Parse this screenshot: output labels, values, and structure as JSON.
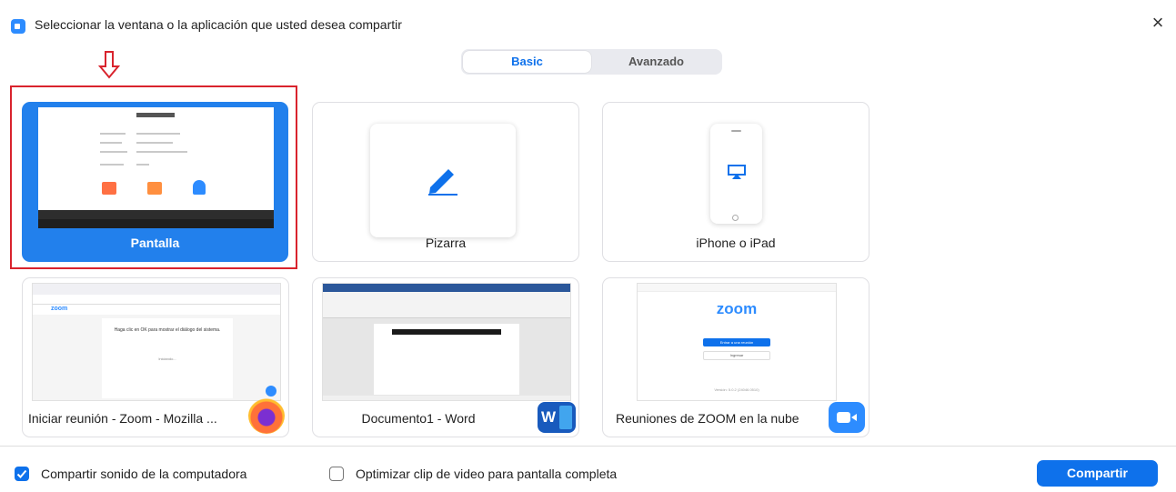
{
  "window": {
    "title": "Seleccionar la ventana o la aplicación que usted desea compartir",
    "close_icon": "close-icon"
  },
  "tabs": [
    {
      "label": "Basic",
      "selected": true
    },
    {
      "label": "Avanzado",
      "selected": false
    }
  ],
  "annotation": {
    "icon": "red-down-arrow-icon",
    "color": "#d9232d"
  },
  "options": [
    {
      "label": "Pantalla",
      "type": "screen",
      "selected": true
    },
    {
      "label": "Pizarra",
      "type": "whiteboard",
      "icon": "pencil-icon"
    },
    {
      "label": "iPhone o iPad",
      "type": "device",
      "icon": "airplay-icon"
    },
    {
      "label": "Iniciar reunión - Zoom - Mozilla ...",
      "type": "window",
      "app_icon": "firefox-icon"
    },
    {
      "label": "Documento1 - Word",
      "type": "window",
      "app_icon": "word-icon"
    },
    {
      "label": "Reuniones de ZOOM en la nube",
      "type": "window",
      "app_icon": "zoom-icon"
    }
  ],
  "previews": {
    "firefox": {
      "logo": "zoom",
      "text": "Haga clic en OK para mostrar el diálogo del sistema.",
      "loading": "Iniciando..."
    },
    "zoom_app": {
      "logo": "zoom",
      "join": "Entrar a una reunión",
      "signin": "Ingresar",
      "version": "Versión: 5.0.2 (24046.0510)"
    }
  },
  "footer": {
    "share_audio": {
      "label": "Compartir sonido de la computadora",
      "checked": true
    },
    "optimize_video": {
      "label": "Optimizar clip de video para pantalla completa",
      "checked": false
    },
    "share_button": "Compartir"
  },
  "colors": {
    "accent": "#0e71eb",
    "selected_card": "#2280ec",
    "highlight": "#d9232d"
  }
}
